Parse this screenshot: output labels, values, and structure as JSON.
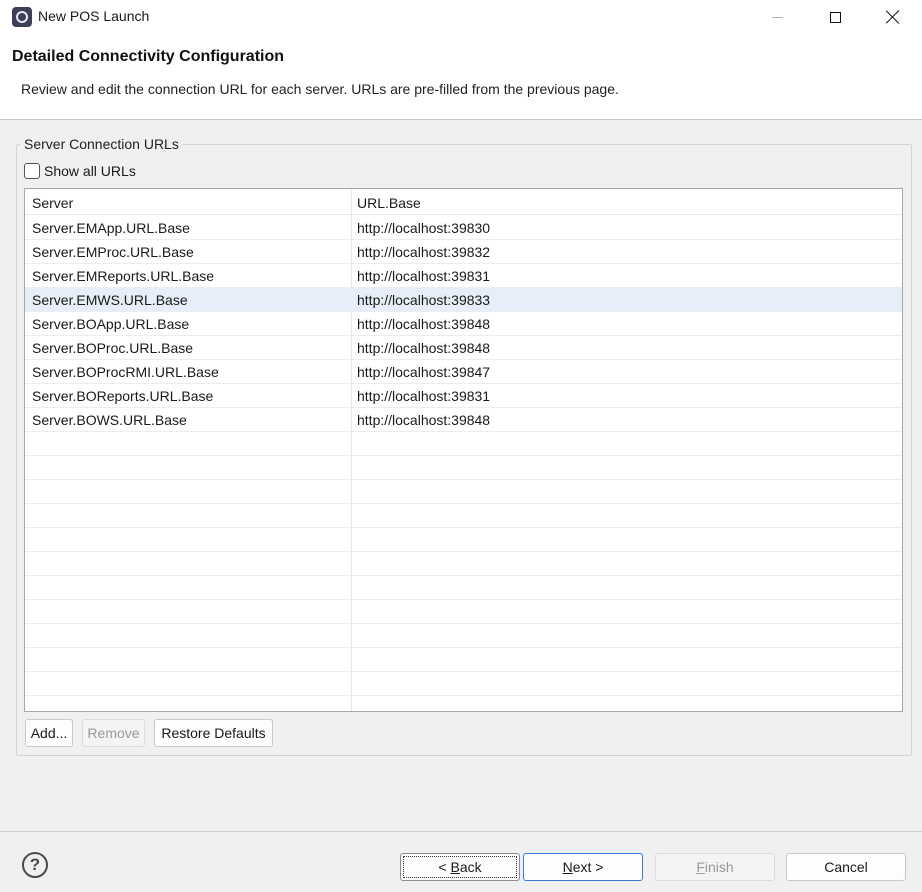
{
  "window": {
    "title": "New POS Launch",
    "icon": "eclipse-app-icon"
  },
  "header": {
    "title": "Detailed Connectivity Configuration",
    "description": "Review and edit the connection URL for each server. URLs are pre-filled from the previous page."
  },
  "group": {
    "label": "Server Connection URLs",
    "show_all_label": "Show all URLs",
    "show_all_checked": false
  },
  "table": {
    "columns": [
      "Server",
      "URL.Base"
    ],
    "rows": [
      {
        "server": "Server.EMApp.URL.Base",
        "url": "http://localhost:39830"
      },
      {
        "server": "Server.EMProc.URL.Base",
        "url": "http://localhost:39832"
      },
      {
        "server": "Server.EMReports.URL.Base",
        "url": "http://localhost:39831"
      },
      {
        "server": "Server.EMWS.URL.Base",
        "url": "http://localhost:39833"
      },
      {
        "server": "Server.BOApp.URL.Base",
        "url": "http://localhost:39848"
      },
      {
        "server": "Server.BOProc.URL.Base",
        "url": "http://localhost:39848"
      },
      {
        "server": "Server.BOProcRMI.URL.Base",
        "url": "http://localhost:39847"
      },
      {
        "server": "Server.BOReports.URL.Base",
        "url": "http://localhost:39831"
      },
      {
        "server": "Server.BOWS.URL.Base",
        "url": "http://localhost:39848"
      }
    ],
    "selected_row": 3
  },
  "table_buttons": {
    "add": "Add...",
    "remove": "Remove",
    "restore": "Restore Defaults"
  },
  "footer": {
    "help": "?",
    "back_prefix": "< ",
    "back_key": "B",
    "back_rest": "ack",
    "next_key": "N",
    "next_rest": "ext >",
    "finish_key": "F",
    "finish_rest": "inish",
    "cancel": "Cancel"
  },
  "colors": {
    "selection": "#e5eef9",
    "default_button_border": "#3a7bd5"
  }
}
